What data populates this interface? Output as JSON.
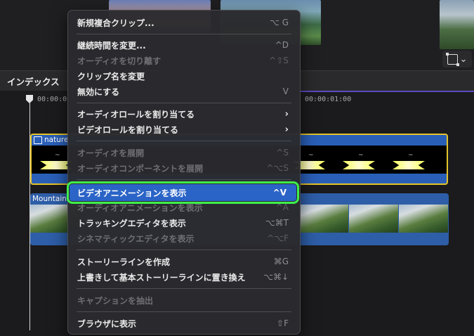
{
  "index_bar": {
    "label": "インデックス"
  },
  "timeline": {
    "ruler": [
      "00:00:0",
      "00:00:01:00"
    ],
    "clips": [
      {
        "name": "nature"
      },
      {
        "name": "Mountains"
      }
    ]
  },
  "colors": {
    "accent_highlight": "#2b64c7",
    "selection_outline": "#3ef04a",
    "selected_clip_border": "#e5c32b"
  },
  "menu": {
    "items": [
      {
        "label": "新規複合クリップ...",
        "shortcut": "⌥ G",
        "disabled": false
      },
      {
        "label": "継続時間を変更...",
        "shortcut": "^D",
        "disabled": false
      },
      {
        "label": "オーディオを切り離す",
        "shortcut": "^⇧S",
        "disabled": true
      },
      {
        "label": "クリップ名を変更",
        "shortcut": "",
        "disabled": false
      },
      {
        "label": "無効にする",
        "shortcut": "V",
        "disabled": false
      },
      {
        "label": "オーディオロールを割り当てる",
        "shortcut": "",
        "submenu": true,
        "disabled": false
      },
      {
        "label": "ビデオロールを割り当てる",
        "shortcut": "",
        "submenu": true,
        "disabled": false
      },
      {
        "label": "オーディオを展開",
        "shortcut": "^S",
        "disabled": true
      },
      {
        "label": "オーディオコンポーネントを展開",
        "shortcut": "^⌥S",
        "disabled": true
      },
      {
        "label": "ビデオアニメーションを表示",
        "shortcut": "^V",
        "disabled": false,
        "highlighted": true
      },
      {
        "label": "オーディオアニメーションを表示",
        "shortcut": "^A",
        "disabled": true
      },
      {
        "label": "トラッキングエディタを表示",
        "shortcut": "⌥⌘T",
        "disabled": false
      },
      {
        "label": "シネマティックエディタを表示",
        "shortcut": "^⌥F",
        "disabled": true
      },
      {
        "label": "ストーリーラインを作成",
        "shortcut": "⌘G",
        "disabled": false
      },
      {
        "label": "上書きして基本ストーリーラインに置き換え",
        "shortcut": "⌥⌘↓",
        "disabled": false
      },
      {
        "label": "キャプションを抽出",
        "shortcut": "",
        "disabled": true
      },
      {
        "label": "ブラウザに表示",
        "shortcut": "⇧F",
        "disabled": false
      }
    ]
  }
}
